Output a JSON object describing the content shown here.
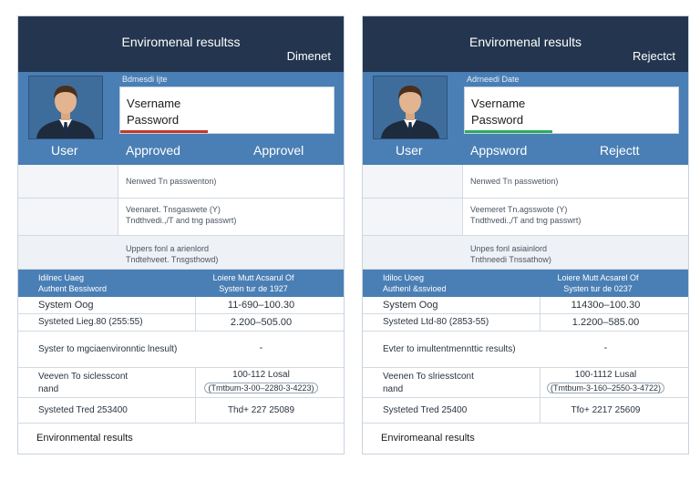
{
  "panels": [
    {
      "title": "Enviromenal resultss",
      "status": "Dimenet",
      "small_label": "Bdmesdi Ijte",
      "username_label": "Vsername",
      "password_label": "Password",
      "bar_color": "#c0392b",
      "labels": [
        "User",
        "Approved",
        "Approvel"
      ],
      "rows": [
        "Nenwed Tn passwenton)",
        "Veenaret. Tnsgaswete (Y)\nTndthvedi.,/T and tng passwrt)",
        "Uppers fonl a arienlord\nTndtehveet. Tnsgsthowd)"
      ],
      "band_left": "Idilnec Uaeg\nAuthent Bessiword",
      "band_right": "Loiere Mutt Acsarul Of\nSysten tur de 1927",
      "table": [
        {
          "c1": "System Oog",
          "c2": "11-690–100.30"
        },
        {
          "c1": "Systeted Lieg.80 (255:55)",
          "c2": "2.200–505.00"
        },
        {
          "c1": "Syster to mgciaenvironntic lnesult)",
          "c2": "-"
        },
        {
          "c1": "Veeven To siclesscont\nnand",
          "c2": "100-112 Losal",
          "c3": "(Tmtbum-3-00–2280-3-4223)"
        },
        {
          "c1": "Systeted Tred 253400",
          "c2": "Thd+ 227 25089"
        }
      ],
      "footer": "Environmental results"
    },
    {
      "title": "Enviromenal results",
      "status": "Rejectct",
      "small_label": "Adrneedi Date",
      "username_label": "Vsername",
      "password_label": "Password",
      "bar_color": "#27ae60",
      "labels": [
        "User",
        "Appsword",
        "Rejectt"
      ],
      "rows": [
        "Nenwed Tn passwetion)",
        "Veemeret Tn.agsswote (Y)\nTndthvedi.,/T and tng passwrt)",
        "Unpes fonl asiainlord\nTnthneedi Tnssathow)"
      ],
      "band_left": "Idiloc Uoeg\nAuthenl &ssvioed",
      "band_right": "Loiere Mutt Acsarel Of\nSysten tur de 0237",
      "table": [
        {
          "c1": "System Oog",
          "c2": "11430o–100.30"
        },
        {
          "c1": "Systeted Ltd-80 (2853-55)",
          "c2": "1.2200–585.00"
        },
        {
          "c1": "Evter to imultentmennttic results)",
          "c2": "-"
        },
        {
          "c1": "Veenen To slriesstcont\nnand",
          "c2": "100-1112 Lusal",
          "c3": "(Tmtbum-3-160–2550-3-4722)"
        },
        {
          "c1": "Systeted Tred 25400",
          "c2": "Tfo+ 2217 25609"
        }
      ],
      "footer": "Enviromeanal results"
    }
  ]
}
